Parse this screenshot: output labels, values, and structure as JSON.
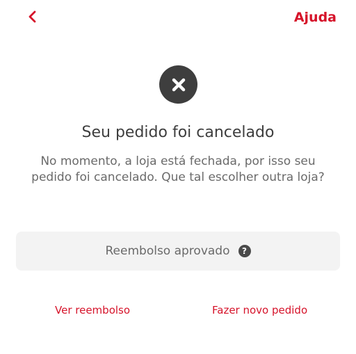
{
  "header": {
    "back_icon": "chevron-left-icon",
    "help_label": "Ajuda",
    "accent_color": "#d6132a"
  },
  "status": {
    "icon": "close-icon",
    "title": "Seu pedido foi cancelado",
    "message": "No momento, a loja está fechada, por isso seu pedido foi cancelado. Que tal escolher outra loja?"
  },
  "refund": {
    "label": "Reembolso aprovado",
    "info_icon": "question-icon",
    "info_symbol": "?"
  },
  "actions": {
    "view_refund_label": "Ver reembolso",
    "new_order_label": "Fazer novo pedido"
  }
}
